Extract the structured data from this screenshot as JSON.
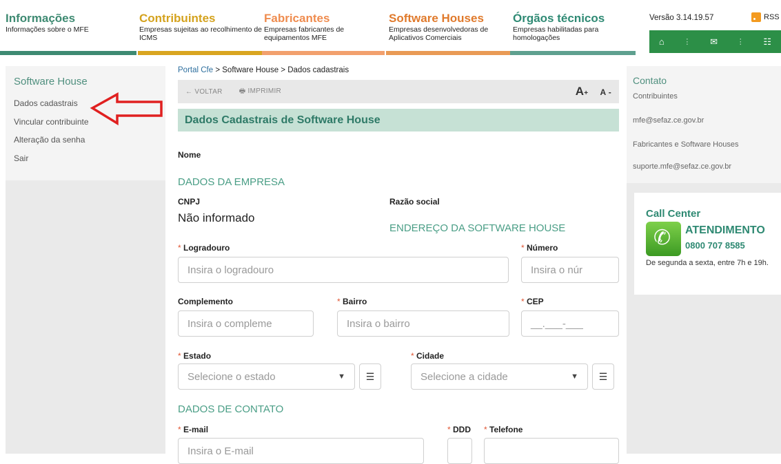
{
  "nav": [
    {
      "title": "Informações",
      "desc": "Informações sobre o MFE"
    },
    {
      "title": "Contribuintes",
      "desc": "Empresas sujeitas ao recolhimento de ICMS"
    },
    {
      "title": "Fabricantes",
      "desc": "Empresas fabricantes de equipamentos MFE"
    },
    {
      "title": "Software Houses",
      "desc": "Empresas desenvolvedoras de Aplicativos Comerciais"
    },
    {
      "title": "Órgãos técnicos",
      "desc": "Empresas habilitadas para homologações"
    }
  ],
  "header": {
    "version": "Versão 3.14.19.57",
    "rss": "RSS",
    "icons": [
      "home-icon",
      "mail-icon",
      "sitemap-icon"
    ]
  },
  "sidebar": {
    "title": "Software House",
    "items": [
      "Dados cadastrais",
      "Vincular contribuinte",
      "Alteração da senha",
      "Sair"
    ]
  },
  "breadcrumb": {
    "root": "Portal Cfe",
    "sep": ">",
    "level1": "Software House",
    "level2": "Dados cadastrais"
  },
  "toolbar": {
    "back": "← VOLTAR",
    "print": "IMPRIMIR",
    "font_up": "A",
    "font_up_sign": "+",
    "font_down": "A",
    "font_down_sign": "-"
  },
  "page_title": "Dados Cadastrais de Software House",
  "form": {
    "nome_label": "Nome",
    "section_empresa": "DADOS DA EMPRESA",
    "cnpj_label": "CNPJ",
    "cnpj_value": "Não informado",
    "razao_label": "Razão social",
    "section_endereco": "ENDEREÇO DA SOFTWARE HOUSE",
    "logradouro_label": "Logradouro",
    "logradouro_placeholder": "Insira o logradouro",
    "numero_label": "Número",
    "numero_placeholder": "Insira o núr",
    "complemento_label": "Complemento",
    "complemento_placeholder": "Insira o compleme",
    "bairro_label": "Bairro",
    "bairro_placeholder": "Insira o bairro",
    "cep_label": "CEP",
    "cep_placeholder": "__.___-___",
    "estado_label": "Estado",
    "estado_placeholder": "Selecione o estado",
    "cidade_label": "Cidade",
    "cidade_placeholder": "Selecione a cidade",
    "section_contato": "DADOS DE CONTATO",
    "email_label": "E-mail",
    "email_placeholder": "Insira o E-mail",
    "ddd_label": "DDD",
    "telefone_label": "Telefone",
    "required_mark": "*"
  },
  "contact": {
    "title": "Contato",
    "contrib_label": "Contribuintes",
    "contrib_email": "mfe@sefaz.ce.gov.br",
    "fab_label": "Fabricantes e Software Houses",
    "fab_email": "suporte.mfe@sefaz.ce.gov.br"
  },
  "call_center": {
    "title": "Call Center",
    "attendance": "ATENDIMENTO",
    "number": "0800 707 8585",
    "hours": "De segunda a sexta, entre 7h e 19h."
  },
  "annotation": {
    "color": "#e02020"
  }
}
